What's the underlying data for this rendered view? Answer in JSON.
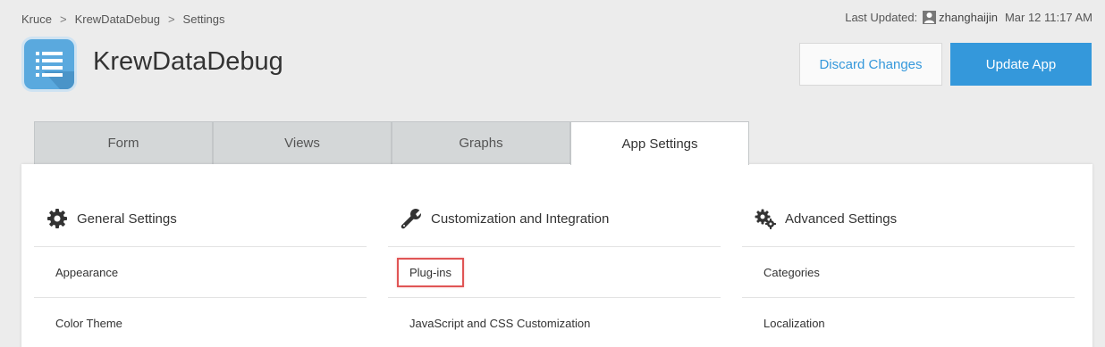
{
  "breadcrumb": {
    "items": [
      "Kruce",
      "KrewDataDebug",
      "Settings"
    ],
    "separator": ">"
  },
  "last_updated": {
    "label": "Last Updated:",
    "user": "zhanghaijin",
    "date": "Mar 12 11:17 AM"
  },
  "app": {
    "title": "KrewDataDebug",
    "icon": "list-app-icon",
    "icon_color": "#5aa9de"
  },
  "actions": {
    "discard_label": "Discard Changes",
    "update_label": "Update App",
    "accent": "#3498db"
  },
  "tabs": [
    {
      "label": "Form",
      "active": false
    },
    {
      "label": "Views",
      "active": false
    },
    {
      "label": "Graphs",
      "active": false
    },
    {
      "label": "App Settings",
      "active": true
    }
  ],
  "sections": [
    {
      "title": "General Settings",
      "icon": "gear-icon",
      "items": [
        "Appearance",
        "Color Theme"
      ]
    },
    {
      "title": "Customization and Integration",
      "icon": "wrench-icon",
      "items": [
        "Plug-ins",
        "JavaScript and CSS Customization"
      ]
    },
    {
      "title": "Advanced Settings",
      "icon": "gears-icon",
      "items": [
        "Categories",
        "Localization"
      ]
    }
  ],
  "highlighted_item": "Plug-ins"
}
